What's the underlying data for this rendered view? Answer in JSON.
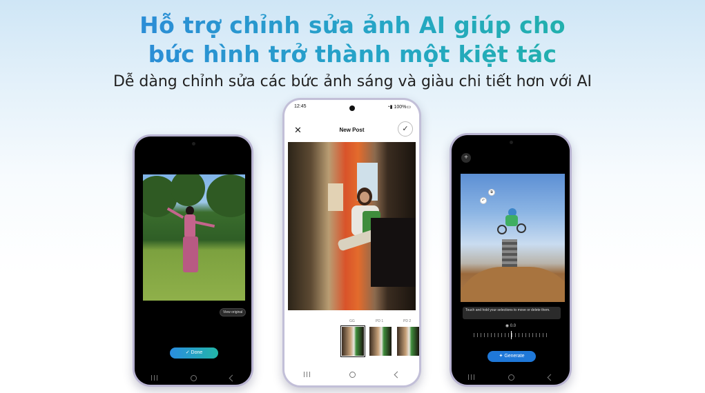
{
  "headline": {
    "line1": "Hỗ trợ chỉnh sửa ảnh AI giúp cho",
    "line2": "bức hình trở thành một kiệt tác",
    "subtitle": "Dễ dàng chỉnh sửa các bức ảnh sáng và giàu chi tiết hơn với AI"
  },
  "phone_left": {
    "view_original": "View original",
    "done_label": "Done",
    "done_icon": "check-icon"
  },
  "phone_mid": {
    "status_time": "12:45",
    "status_battery": "100%",
    "header_title": "New Post",
    "close_icon": "close-icon",
    "confirm_icon": "check-icon",
    "thumb_labels": [
      "GG",
      "PD 1",
      "PD 2"
    ]
  },
  "phone_right": {
    "hint_text": "Touch and hold your selections to move or delete them.",
    "slider_value": "0.0",
    "generate_label": "Generate",
    "generate_icon": "sparkle-icon"
  },
  "colors": {
    "headline_gradient_start": "#2f7fe0",
    "headline_gradient_end": "#1fb89a",
    "done_button": "#2a8de0",
    "generate_button": "#1f78d8"
  }
}
